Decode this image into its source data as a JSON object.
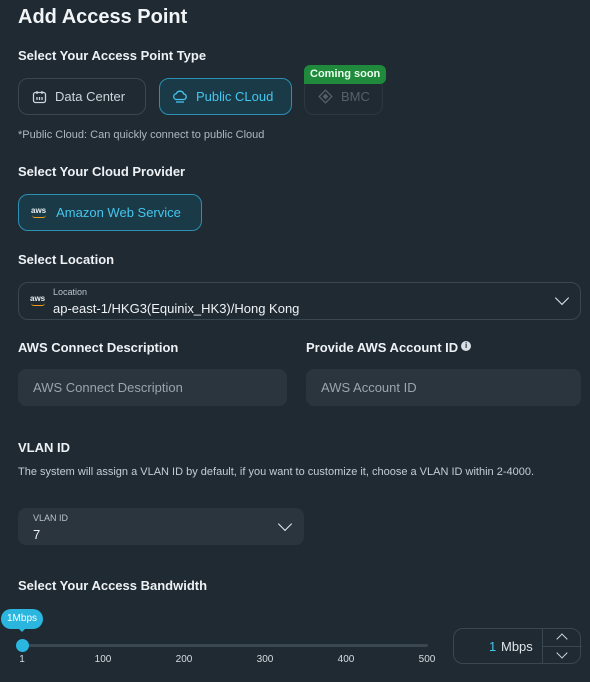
{
  "title": "Add Access Point",
  "access_point_type": {
    "label": "Select Your Access Point Type",
    "options": [
      {
        "label": "Data Center",
        "icon": "building-icon",
        "state": "default"
      },
      {
        "label": "Public CLoud",
        "icon": "cloud-icon",
        "state": "selected"
      },
      {
        "label": "BMC",
        "icon": "diamond-icon",
        "state": "disabled"
      }
    ],
    "badge": "Coming soon",
    "note": "*Public Cloud: Can quickly connect to public Cloud"
  },
  "cloud_provider": {
    "label": "Select Your Cloud Provider",
    "selected": "Amazon Web Service",
    "logo_text": "aws"
  },
  "location": {
    "label": "Select Location",
    "field_label": "Location",
    "value": "ap-east-1/HKG3(Equinix_HK3)/Hong Kong",
    "logo_text": "aws"
  },
  "aws_description": {
    "label": "AWS Connect Description",
    "placeholder": "AWS Connect Description",
    "value": ""
  },
  "aws_account": {
    "label": "Provide AWS Account ID",
    "info_icon": "i",
    "placeholder": "AWS Account ID",
    "value": ""
  },
  "vlan": {
    "label": "VLAN ID",
    "description": "The system will assign a VLAN ID by default, if you want to customize it, choose a VLAN ID within 2-4000.",
    "field_label": "VLAN ID",
    "value": "7"
  },
  "bandwidth": {
    "label": "Select Your Access Bandwidth",
    "tooltip": "1Mbps",
    "value": "1",
    "unit": "Mbps",
    "ticks": [
      "1",
      "100",
      "200",
      "300",
      "400",
      "500"
    ],
    "min": 1,
    "max": 500
  },
  "colors": {
    "background": "#1f2a33",
    "accent": "#44c6ee",
    "badge": "#1f8a3c"
  }
}
